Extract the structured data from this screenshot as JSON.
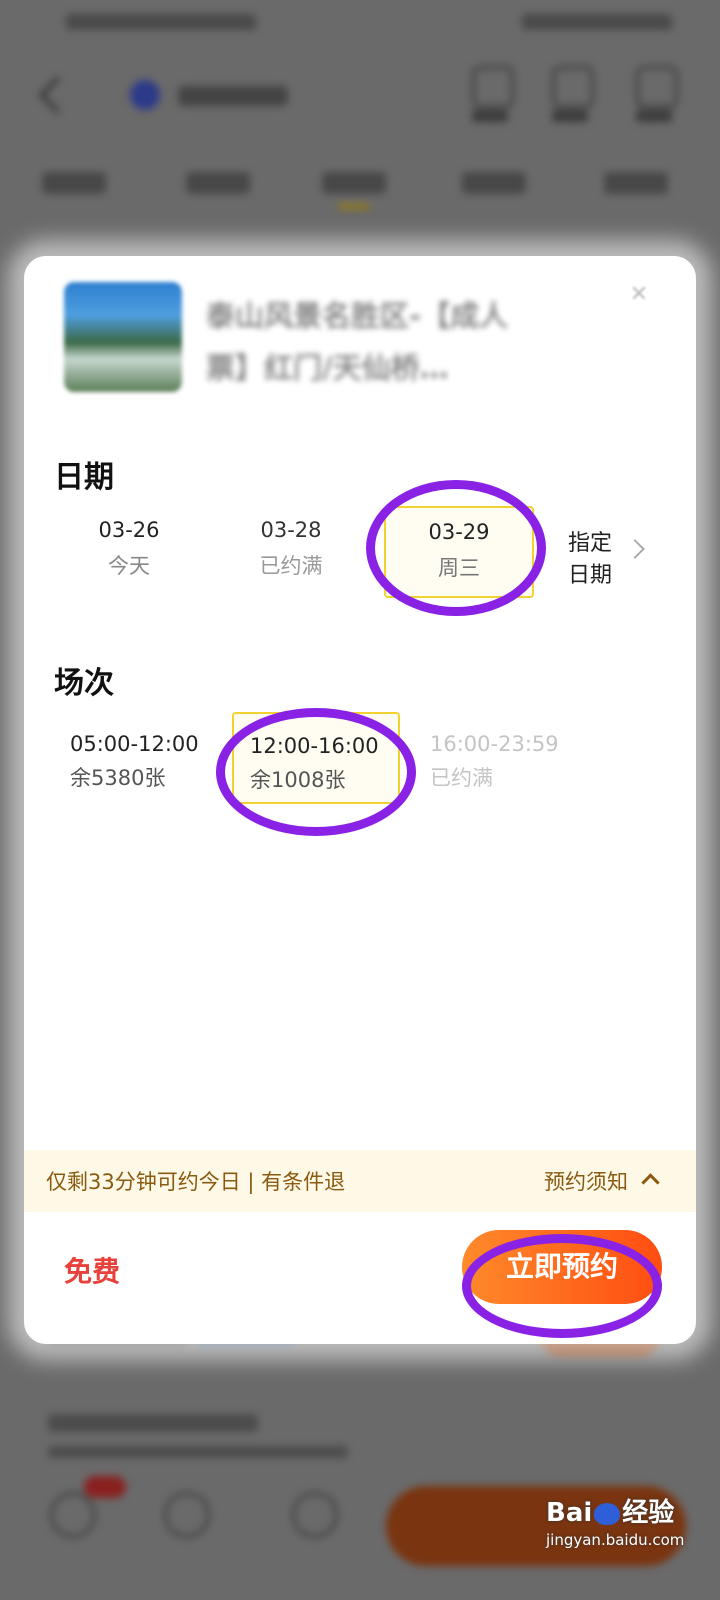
{
  "background": {
    "note": ""
  },
  "product": {
    "title": "泰山风景名胜区-【成人票】红门/天仙桥…"
  },
  "date_section": {
    "heading": "日期",
    "items": [
      {
        "date": "03-26",
        "sub": "今天",
        "state": "available"
      },
      {
        "date": "03-28",
        "sub": "已约满",
        "state": "full"
      },
      {
        "date": "03-29",
        "sub": "周三",
        "state": "selected"
      }
    ],
    "specify_label_1": "指定",
    "specify_label_2": "日期"
  },
  "session_section": {
    "heading": "场次",
    "items": [
      {
        "time": "05:00-12:00",
        "remain": "余5380张",
        "state": "available"
      },
      {
        "time": "12:00-16:00",
        "remain": "余1008张",
        "state": "selected"
      },
      {
        "time": "16:00-23:59",
        "remain": "已约满",
        "state": "full"
      }
    ]
  },
  "notice": {
    "left": "仅剩33分钟可约今日 | 有条件退",
    "right": "预约须知"
  },
  "footer": {
    "price": "免费",
    "book_button": "立即预约"
  },
  "watermark": {
    "brand_prefix": "Bai",
    "brand_suffix": "经验",
    "url": "jingyan.baidu.com"
  },
  "colors": {
    "accent": "#ff5a14",
    "price": "#e8403a",
    "selected_border": "#f2d230",
    "annotation": "#8a22e6"
  }
}
